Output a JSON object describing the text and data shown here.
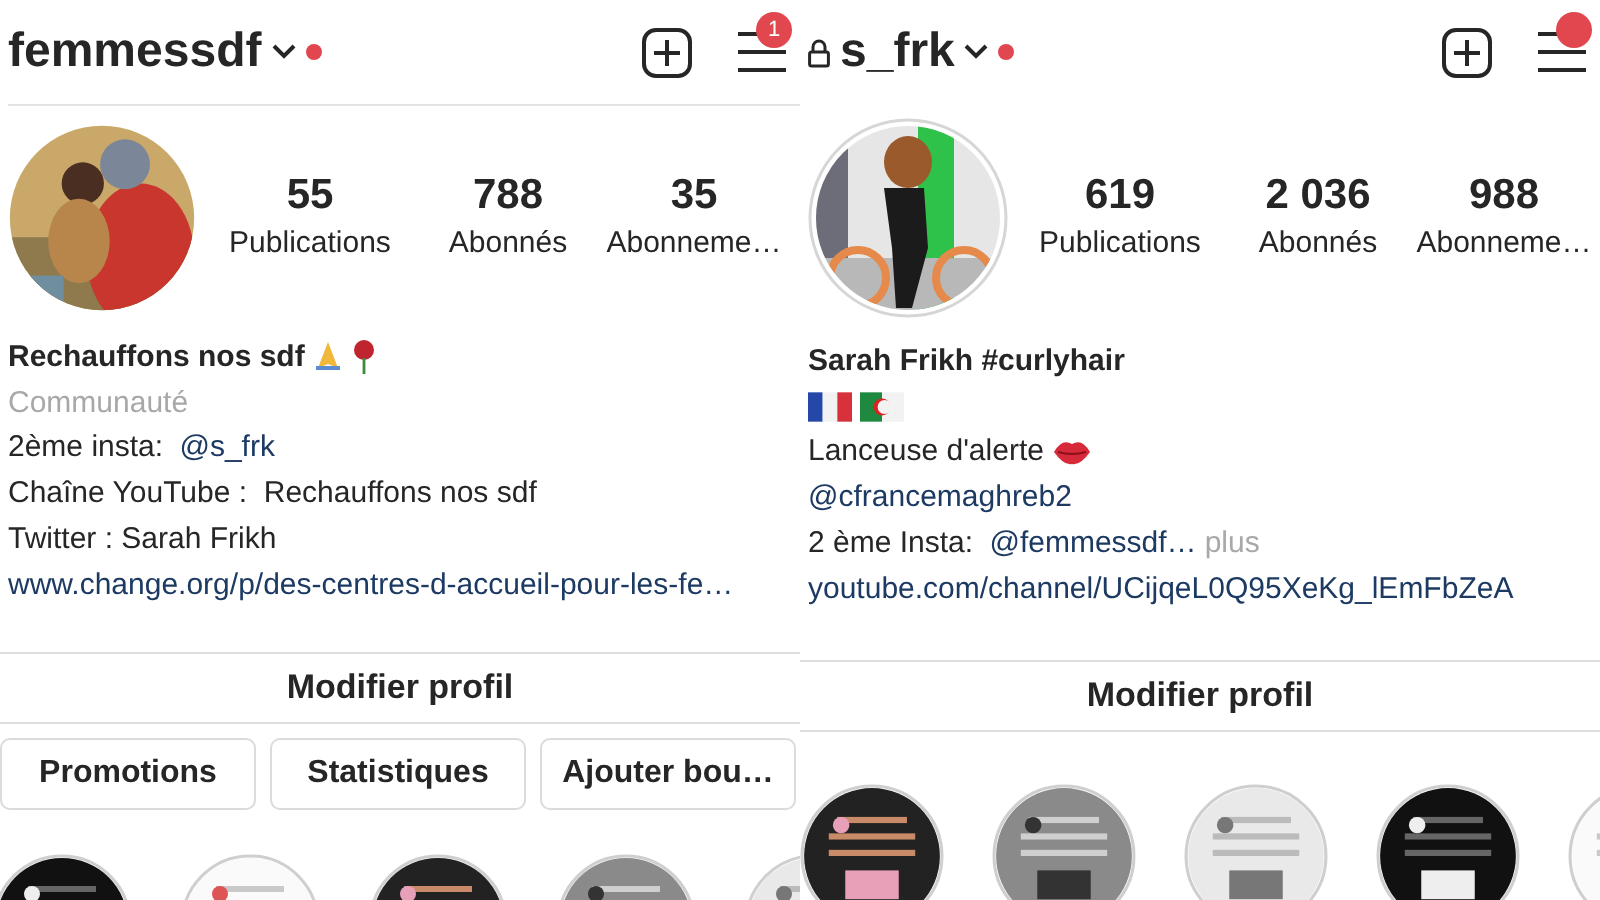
{
  "profiles": [
    {
      "username": "femmessdf",
      "locked": false,
      "menu_badge": true,
      "badge_count": "1",
      "avatar": {
        "kind": "picture",
        "ring": false
      },
      "stats": [
        {
          "count": "55",
          "label": "Publications"
        },
        {
          "count": "788",
          "label": "Abonnés"
        },
        {
          "count": "35",
          "label": "Abonneme…"
        }
      ],
      "bio": [
        [
          {
            "kind": "bold",
            "text": "Rechauffons nos sdf"
          },
          {
            "kind": "pray"
          },
          {
            "kind": "rose"
          }
        ],
        [
          {
            "kind": "muted",
            "text": "Communauté"
          }
        ],
        [
          {
            "kind": "plain",
            "text": "2ème insta: "
          },
          {
            "kind": "link",
            "text": "@s_frk"
          }
        ],
        [
          {
            "kind": "plain",
            "text": "Chaîne YouTube :  Rechauffons nos sdf"
          }
        ],
        [
          {
            "kind": "plain",
            "text": "Twitter : Sarah Frikh"
          }
        ],
        [
          {
            "kind": "link",
            "text": "www.change.org/p/des-centres-d-accueil-pour-les-fe…"
          }
        ]
      ],
      "edit_button": "Modifier profil",
      "action_buttons": [
        "Promotions",
        "Statistiques",
        "Ajouter bou…"
      ],
      "highlights": [
        {
          "kind": "picture"
        },
        {
          "kind": "picture"
        },
        {
          "kind": "picture"
        },
        {
          "kind": "picture"
        },
        {
          "kind": "picture"
        }
      ]
    },
    {
      "username": "s_frk",
      "locked": true,
      "menu_badge": true,
      "avatar": {
        "kind": "picture",
        "ring": true
      },
      "stats": [
        {
          "count": "619",
          "label": "Publications"
        },
        {
          "count": "2 036",
          "label": "Abonnés"
        },
        {
          "count": "988",
          "label": "Abonneme…"
        }
      ],
      "bio": [
        [
          {
            "kind": "bold",
            "text": "Sarah Frikh #curlyhair"
          }
        ],
        [
          {
            "kind": "flag_fr"
          },
          {
            "kind": "flag_dz"
          }
        ],
        [
          {
            "kind": "plain",
            "text": "Lanceuse d'alerte"
          },
          {
            "kind": "lips"
          }
        ],
        [
          {
            "kind": "link",
            "text": "@cfrancemaghreb2"
          }
        ],
        [
          {
            "kind": "plain",
            "text": "2 ème Insta: "
          },
          {
            "kind": "link",
            "text": "@femmessdf…"
          },
          {
            "kind": "muted",
            "text": "plus"
          }
        ],
        [
          {
            "kind": "link",
            "text": "youtube.com/channel/UCijqeL0Q95XeKg_lEmFbZeA"
          }
        ]
      ],
      "edit_button": "Modifier profil",
      "highlights": [
        {
          "kind": "picture"
        },
        {
          "kind": "picture"
        },
        {
          "kind": "picture"
        },
        {
          "kind": "picture"
        },
        {
          "kind": "picture"
        }
      ]
    }
  ]
}
